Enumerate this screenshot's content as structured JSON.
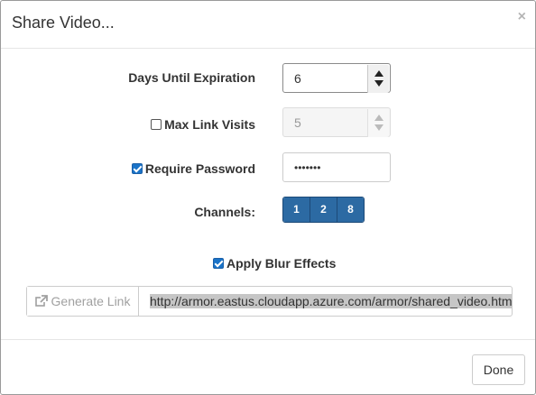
{
  "dialog": {
    "title": "Share Video...",
    "close_glyph": "×"
  },
  "form": {
    "days_until_expiration": {
      "label": "Days Until Expiration",
      "value": "6"
    },
    "max_link_visits": {
      "label": "Max Link Visits",
      "checked": false,
      "value": "5",
      "disabled": true
    },
    "require_password": {
      "label": "Require Password",
      "checked": true,
      "value": "•••••••"
    },
    "channels": {
      "label": "Channels:",
      "buttons": [
        "1",
        "2",
        "8"
      ]
    },
    "apply_blur": {
      "label": "Apply Blur Effects",
      "checked": true
    }
  },
  "link": {
    "generate_label": "Generate Link",
    "generate_icon": "external-link-icon",
    "url": "http://armor.eastus.cloudapp.azure.com/armor/shared_video.html"
  },
  "footer": {
    "done_label": "Done"
  },
  "colors": {
    "accent": "#2c6aa3",
    "checkbox": "#1a73c8"
  }
}
